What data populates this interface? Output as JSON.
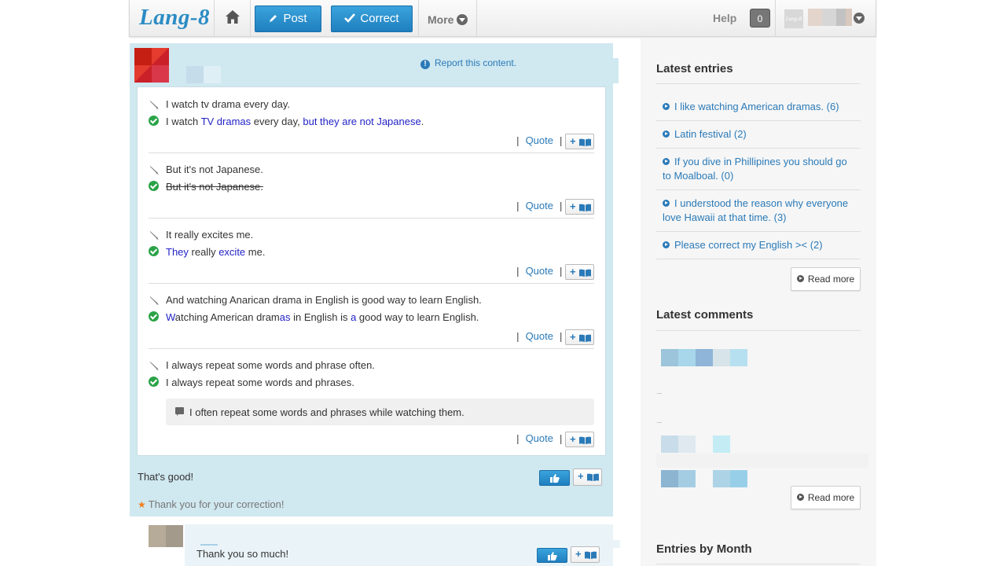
{
  "header": {
    "logo": "Lang-8",
    "post_label": "Post",
    "correct_label": "Correct",
    "more_label": "More",
    "help_label": "Help",
    "notification_count": "0",
    "avatar_logo": "Lang-8"
  },
  "post": {
    "report_label": "Report this content.",
    "corrections": [
      {
        "original": "I watch tv drama every day.",
        "corrected_parts": [
          {
            "t": "I watch ",
            "c": "n"
          },
          {
            "t": "TV dramas",
            "c": "h"
          },
          {
            "t": " every day, ",
            "c": "n"
          },
          {
            "t": "but they are not Japanese",
            "c": "h"
          },
          {
            "t": ".",
            "c": "n"
          }
        ]
      },
      {
        "original": "But it's not Japanese.",
        "corrected_parts": [
          {
            "t": "But it's not Japanese.",
            "c": "s"
          }
        ]
      },
      {
        "original": "It really excites me.",
        "corrected_parts": [
          {
            "t": "They",
            "c": "h"
          },
          {
            "t": " really ",
            "c": "n"
          },
          {
            "t": "excite",
            "c": "h"
          },
          {
            "t": " me.",
            "c": "n"
          }
        ]
      },
      {
        "original": "And watching Anarican drama in English is good way to learn English.",
        "corrected_parts": [
          {
            "t": "W",
            "c": "h"
          },
          {
            "t": "atching American dram",
            "c": "n"
          },
          {
            "t": "as",
            "c": "h"
          },
          {
            "t": " in English is ",
            "c": "n"
          },
          {
            "t": "a",
            "c": "h"
          },
          {
            "t": " good way to learn English.",
            "c": "n"
          }
        ]
      },
      {
        "original": "I always repeat some words and phrase often.",
        "corrected_parts": [
          {
            "t": "I always repeat some words and phrases.",
            "c": "n"
          }
        ],
        "comment": "I often repeat some words and phrases while watching them."
      }
    ],
    "quote_label": "Quote",
    "plus_label": "+",
    "footer_comment": "That's good!",
    "thanks_text": "Thank you for your correction!",
    "reply_text": "Thank you so much!"
  },
  "sidebar": {
    "latest_entries_title": "Latest entries",
    "entries": [
      "I like watching American dramas. (6)",
      "Latin festival (2)",
      "If you dive in Phillipines you should go to Moalboal. (0)",
      "I understood the reason why everyone love Hawaii at that time. (3)",
      "Please correct my English >< (2)"
    ],
    "read_more_label": "Read more",
    "latest_comments_title": "Latest comments",
    "entries_by_month_title": "Entries by Month"
  },
  "colors": {
    "accent": "#2a7ab8",
    "button_blue": "#1f7fbf",
    "panel_blue": "#d0e8f0",
    "highlight": "#2323c8",
    "check_green": "#2aa347"
  }
}
